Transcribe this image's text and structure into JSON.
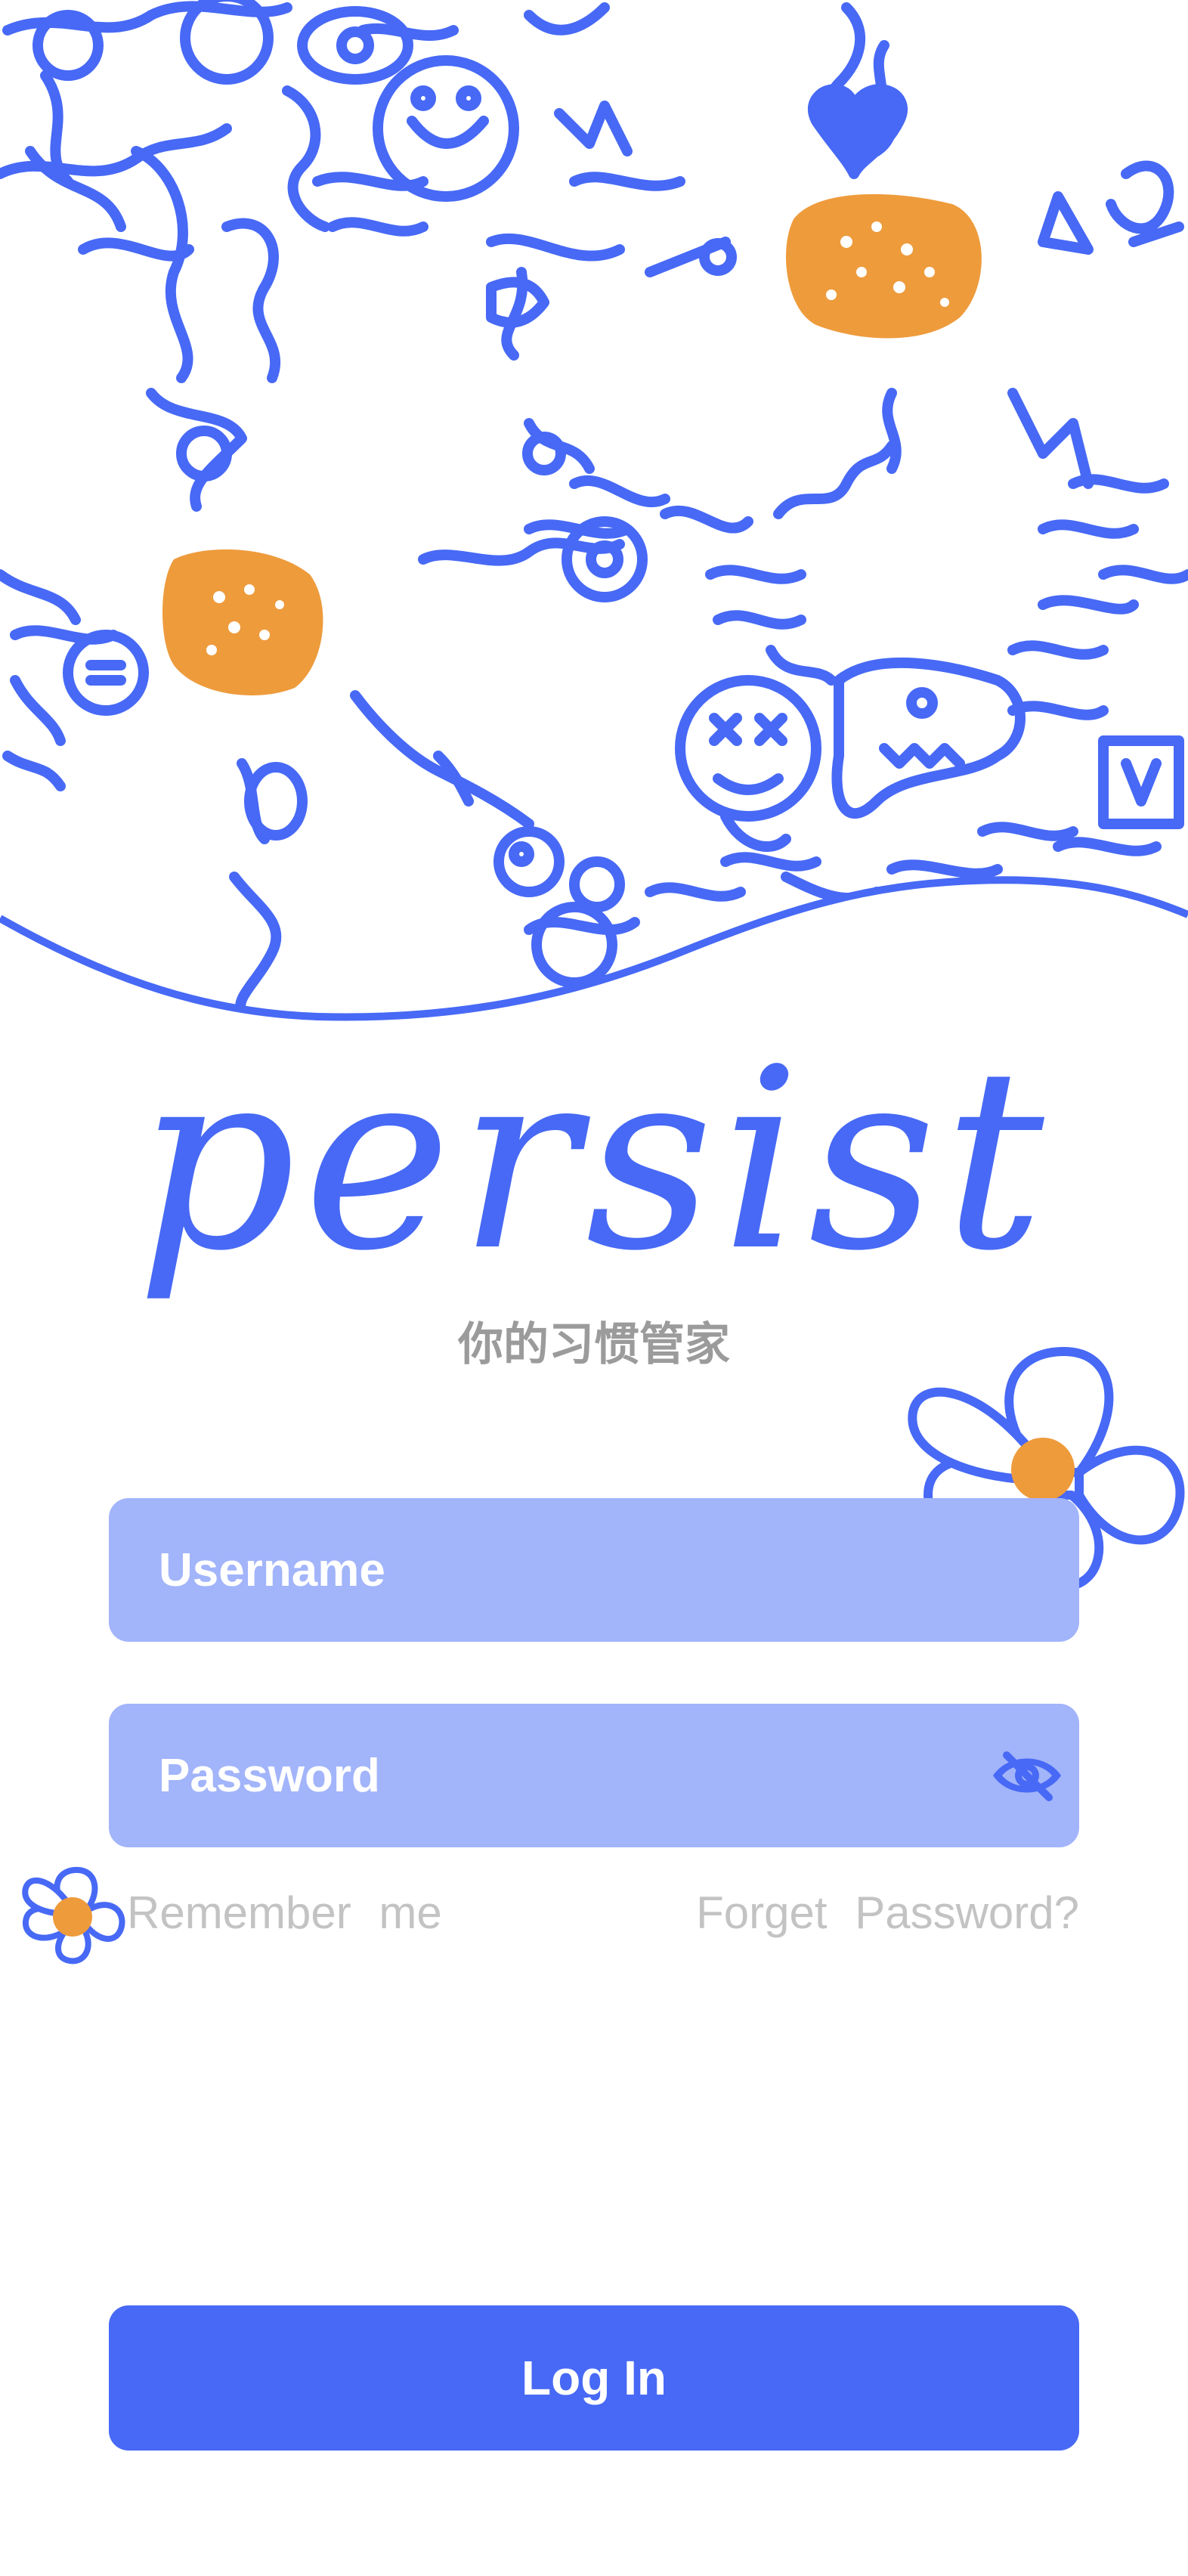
{
  "app": {
    "logo_text": "persist",
    "tagline": "你的习惯管家"
  },
  "form": {
    "username_placeholder": "Username",
    "password_placeholder": "Password",
    "remember_label": "Remember me",
    "forget_label": "Forget Password?",
    "login_label": "Log In"
  },
  "icons": {
    "eye": "eye-slash-icon",
    "flower": "flower-icon"
  },
  "colors": {
    "primary": "#4769f5",
    "field_bg": "#a2b4fa",
    "accent_orange": "#ee9b3c",
    "muted_text": "#c3c3c3",
    "tagline_text": "#9b9b9b"
  }
}
